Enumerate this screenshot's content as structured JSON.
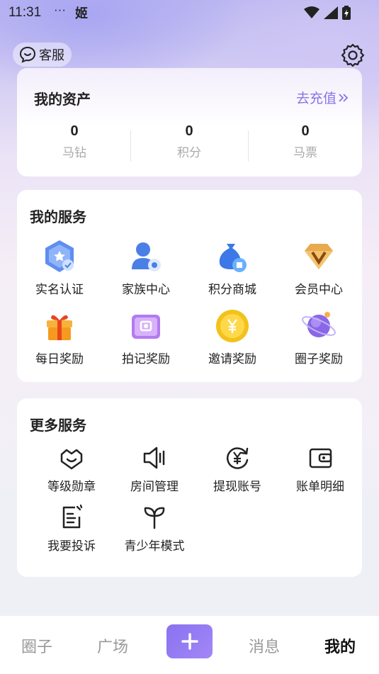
{
  "status": {
    "time": "11:31",
    "dots": "···",
    "app_glyph": "姬"
  },
  "header": {
    "customer_service": "客服"
  },
  "assets": {
    "title": "我的资产",
    "recharge": "去充值",
    "items": [
      {
        "value": "0",
        "label": "马钻"
      },
      {
        "value": "0",
        "label": "积分"
      },
      {
        "value": "0",
        "label": "马票"
      }
    ]
  },
  "services": {
    "title": "我的服务",
    "items": [
      {
        "label": "实名认证",
        "icon": "verify-badge-icon"
      },
      {
        "label": "家族中心",
        "icon": "family-user-icon"
      },
      {
        "label": "积分商城",
        "icon": "points-bag-icon"
      },
      {
        "label": "会员中心",
        "icon": "diamond-v-icon"
      },
      {
        "label": "每日奖励",
        "icon": "gift-box-icon"
      },
      {
        "label": "拍记奖励",
        "icon": "camera-icon"
      },
      {
        "label": "邀请奖励",
        "icon": "yuan-coin-icon"
      },
      {
        "label": "圈子奖励",
        "icon": "planet-icon"
      }
    ]
  },
  "more": {
    "title": "更多服务",
    "items": [
      {
        "label": "等级勋章",
        "icon": "medal-icon"
      },
      {
        "label": "房间管理",
        "icon": "speaker-icon"
      },
      {
        "label": "提现账号",
        "icon": "withdraw-yuan-icon"
      },
      {
        "label": "账单明细",
        "icon": "wallet-icon"
      },
      {
        "label": "我要投诉",
        "icon": "complaint-note-icon"
      },
      {
        "label": "青少年模式",
        "icon": "sprout-icon"
      }
    ]
  },
  "tabs": [
    {
      "label": "圈子"
    },
    {
      "label": "广场"
    },
    {
      "label": "消息"
    },
    {
      "label": "我的"
    }
  ],
  "colors": {
    "accent": "#8a73e6",
    "primary_button": "#9279f2"
  }
}
